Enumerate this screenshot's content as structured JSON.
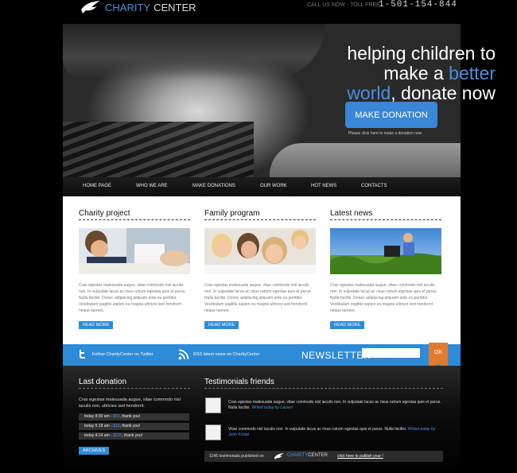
{
  "logo": {
    "part1": "CHARITY",
    "part2": "CENTER"
  },
  "header": {
    "call_label": "CALL US NOW - TOLL FREE",
    "phone": "1-501-154-844"
  },
  "hero": {
    "line1": "helping children to",
    "line2_pre": "make a ",
    "line2_blue": "better",
    "line3_blue": "world",
    "line3_post": ", donate now",
    "button": "MAKE DONATION",
    "note": "Please click here to make a donation now"
  },
  "nav": [
    "HOME PAGE",
    "WHO WE ARE",
    "MAKE DONATIONS",
    "OUR WORK",
    "HOT NEWS",
    "CONTACTS"
  ],
  "columns": [
    {
      "title": "Charity project",
      "text": "Cras egestas malesuada augue, vitae commodo nisl iaculis non. In vulputate lacus ac risus rutrum egestas quis et purus. Nulla facilisi. Donec adipiscing aliquam ante eu porttitor. Vestibulum sagittis sapien eu magna ultrices sed hendrerit neque laoreet.",
      "button": "READ MORE"
    },
    {
      "title": "Family program",
      "text": "Cras egestas malesuada augue, vitae commodo nisl iaculis non. In vulputate lacus ac risus rutrum egestas quis et purus. Nulla facilisi. Donec adipiscing aliquam ante eu porttitor. Vestibulum sagittis sapien eu magna ultrices sed hendrerit neque laoreet.",
      "button": "READ MORE"
    },
    {
      "title": "Latest news",
      "text": "Cras egestas malesuada augue, vitae commodo nisl iaculis non. In vulputate lacus ac risus rutrum egestas quis et purus. Nulla facilisi. Donec adipiscing aliquam ante eu porttitor. Vestibulum sagittis sapien eu magna ultrices sed hendrerit neque laoreet.",
      "button": "READ MORE"
    }
  ],
  "social": {
    "twitter": "Follow CharityCenter on Twitter",
    "rss": "RSS latest news on CharityCenter"
  },
  "newsletter": {
    "title": "NEWSLETTER",
    "placeholder": "",
    "ok": "OK"
  },
  "last_donation": {
    "title": "Last donation",
    "text": "Cras egestas malesuada augue, vitae commodo nisl iaculis non. ultricies sed hendrerit.",
    "rows": [
      {
        "time": "today 8:30 am - ",
        "amount": "$50",
        "thanks": ", thank you!"
      },
      {
        "time": "today 5:18 am - ",
        "amount": "$10",
        "thanks": ", thank you!"
      },
      {
        "time": "today 4:14 am - ",
        "amount": "$220",
        "thanks": ", thank you!"
      }
    ],
    "archives": "ARCHIVES"
  },
  "testimonials": {
    "title": "Testimonials friends",
    "items": [
      {
        "text": "Cras egestas malesuada augue, vitae commodo nisl iaculis non. In vulputate lacus ac risus rutrum egestas quis et purus. Nulla facilisi. ",
        "author": "Writed today by Lauren"
      },
      {
        "text": "Vitae commodo nisl iaculis non. In vulputate lacus ac risus rutrum egestas quis et purus. Nulla facilisi. ",
        "author": "Writed today by John Kristal"
      }
    ],
    "count_text": "1245 testimonials published on",
    "brand1": "CHARITY",
    "brand2": "CENTER",
    "publish_link": "click here to publish your !"
  },
  "colors": {
    "accent": "#2e8bd8",
    "highlight": "#4a90e2",
    "ok": "#e27b2f"
  }
}
